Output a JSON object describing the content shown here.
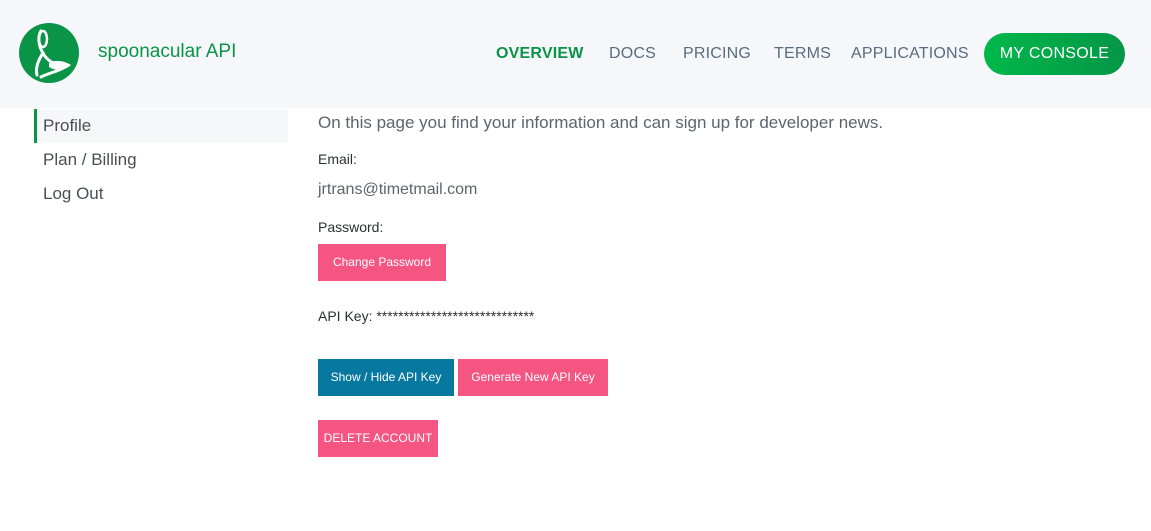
{
  "header": {
    "brand": "spoonacular API",
    "nav": [
      {
        "label": "OVERVIEW",
        "active": true
      },
      {
        "label": "DOCS",
        "active": false
      },
      {
        "label": "PRICING",
        "active": false
      },
      {
        "label": "TERMS",
        "active": false
      },
      {
        "label": "APPLICATIONS",
        "active": false
      }
    ],
    "console_button": "MY CONSOLE"
  },
  "sidebar": {
    "items": [
      {
        "label": "Profile",
        "active": true
      },
      {
        "label": "Plan / Billing",
        "active": false
      },
      {
        "label": "Log Out",
        "active": false
      }
    ]
  },
  "profile": {
    "intro": "On this page you find your information and can sign up for developer news.",
    "email_label": "Email:",
    "email_value": "jrtrans@timetmail.com",
    "password_label": "Password:",
    "change_password_button": "Change Password",
    "api_key_label": "API Key:",
    "api_key_value": "*****************************",
    "show_hide_button": "Show / Hide API Key",
    "generate_button": "Generate New API Key",
    "delete_button": "DELETE ACCOUNT"
  },
  "colors": {
    "brand_green": "#0a9447",
    "pink": "#f45582",
    "teal": "#0779a0",
    "header_bg": "#f6f7fb"
  }
}
